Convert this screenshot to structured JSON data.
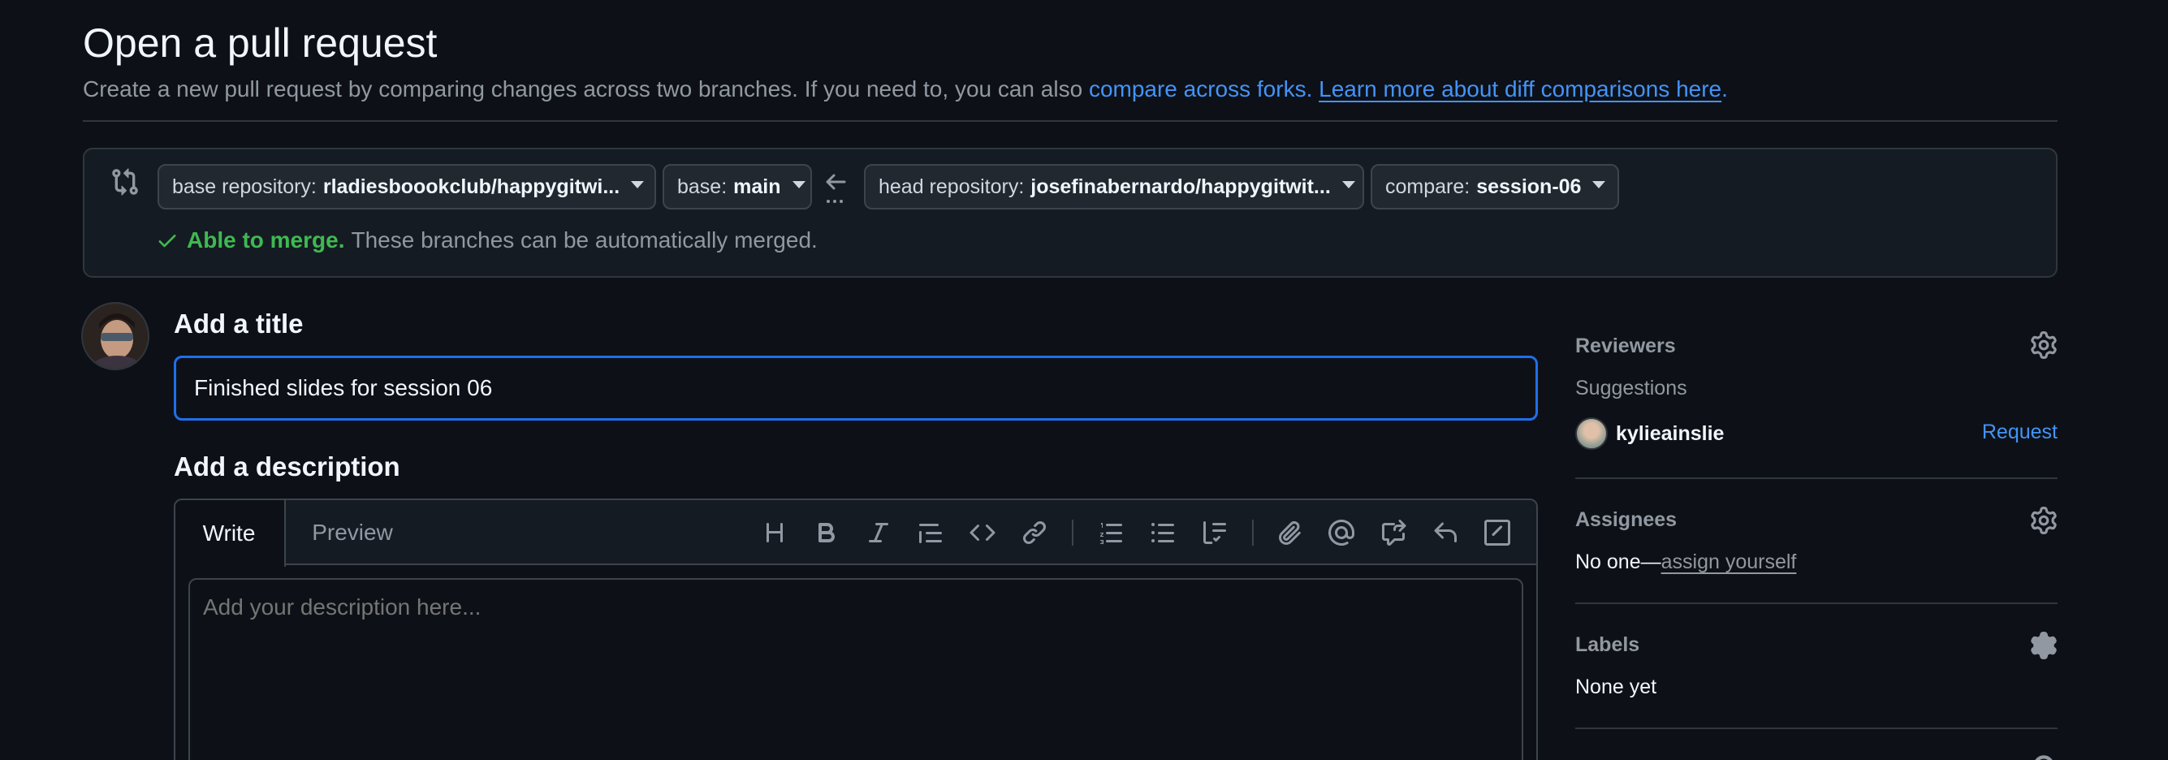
{
  "header": {
    "title": "Open a pull request",
    "subtitle": "Create a new pull request by comparing changes across two branches. If you need to, you can also",
    "link_forks": "compare across forks.",
    "link_learn": "Learn more about diff comparisons here",
    "period": "."
  },
  "compare": {
    "base_repo_prefix": "base repository:",
    "base_repo_value": "rladiesboookclub/happygitwi...",
    "base_prefix": "base:",
    "base_value": "main",
    "head_repo_prefix": "head repository:",
    "head_repo_value": "josefinabernardo/happygitwit...",
    "compare_prefix": "compare:",
    "compare_value": "session-06",
    "merge_status": "Able to merge.",
    "merge_text": "These branches can be automatically merged."
  },
  "form": {
    "title_heading": "Add a title",
    "title_value": "Finished slides for session 06",
    "description_heading": "Add a description",
    "tab_write": "Write",
    "tab_preview": "Preview",
    "description_placeholder": "Add your description here..."
  },
  "sidebar": {
    "reviewers": {
      "label": "Reviewers",
      "suggestions_label": "Suggestions",
      "suggested_user": "kylieainslie",
      "request_label": "Request"
    },
    "assignees": {
      "label": "Assignees",
      "none_text": "No one—",
      "assign_link": "assign yourself"
    },
    "labels": {
      "label": "Labels",
      "none_text": "None yet"
    }
  },
  "colors": {
    "background": "#0d1117",
    "accent_blue": "#4493f8",
    "success_green": "#3fb950",
    "focus_border": "#1f6feb"
  },
  "icons": {
    "compare": "git-compare-icon",
    "arrow": "arrow-left-icon",
    "check": "check-icon",
    "gear": "gear-icon"
  }
}
